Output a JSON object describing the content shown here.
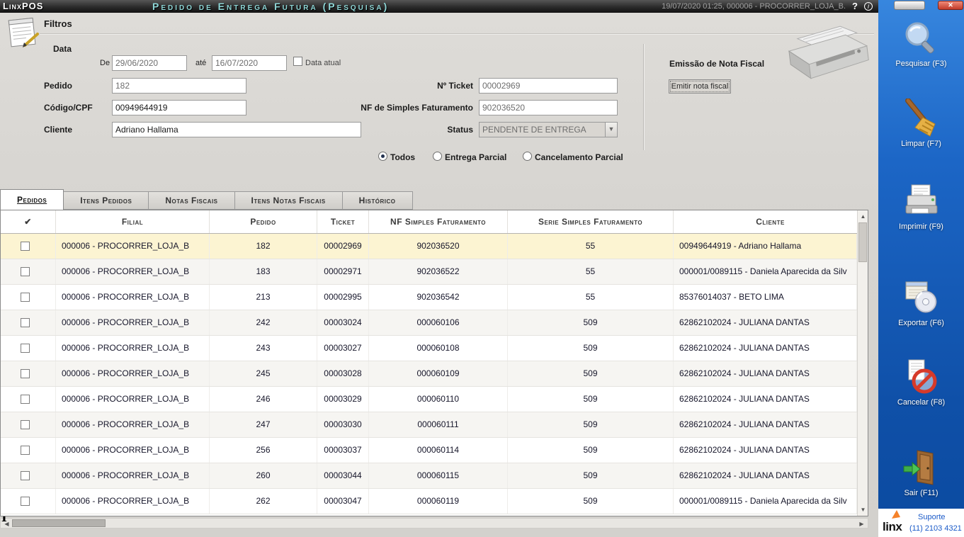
{
  "titlebar": {
    "app": "LinxPOS",
    "title": "Pedido de Entrega Futura (Pesquisa)",
    "session": "19/07/2020 01:25, 000006 - PROCORRER_LOJA_B.",
    "help_glyph": "?",
    "info_glyph": "i",
    "close_glyph": "✕"
  },
  "filters": {
    "heading": "Filtros",
    "data_label": "Data",
    "de_label": "De",
    "de_value": "29/06/2020",
    "ate_label": "até",
    "ate_value": "16/07/2020",
    "data_atual_label": "Data atual",
    "pedido_label": "Pedido",
    "pedido_value": "182",
    "codigo_label": "Código/CPF",
    "codigo_value": "00949644919",
    "cliente_label": "Cliente",
    "cliente_value": "Adriano Hallama",
    "ticket_label": "Nº Ticket",
    "ticket_value": "00002969",
    "nf_label": "NF de Simples Faturamento",
    "nf_value": "902036520",
    "status_label": "Status",
    "status_value": "PENDENTE DE ENTREGA",
    "radios": [
      {
        "label": "Todos",
        "checked": true
      },
      {
        "label": "Entrega Parcial",
        "checked": false
      },
      {
        "label": "Cancelamento Parcial",
        "checked": false
      }
    ],
    "emissao_label": "Emissão de Nota Fiscal",
    "emitir_button": "Emitir nota fiscal"
  },
  "tabs": [
    {
      "label": "Pedidos"
    },
    {
      "label": "Itens Pedidos"
    },
    {
      "label": "Notas Fiscais"
    },
    {
      "label": "Itens Notas Fiscais"
    },
    {
      "label": "Histórico"
    }
  ],
  "table": {
    "check_header_glyph": "✔",
    "columns": [
      "Filial",
      "Pedido",
      "Ticket",
      "NF Simples Faturamento",
      "Serie Simples Faturamento",
      "Cliente"
    ],
    "rows": [
      {
        "filial": "000006 - PROCORRER_LOJA_B",
        "pedido": "182",
        "ticket": "00002969",
        "nf": "902036520",
        "serie": "55",
        "cliente": "00949644919 - Adriano Hallama",
        "selected": true
      },
      {
        "filial": "000006 - PROCORRER_LOJA_B",
        "pedido": "183",
        "ticket": "00002971",
        "nf": "902036522",
        "serie": "55",
        "cliente": "000001/0089115 - Daniela Aparecida da Silv",
        "selected": false
      },
      {
        "filial": "000006 - PROCORRER_LOJA_B",
        "pedido": "213",
        "ticket": "00002995",
        "nf": "902036542",
        "serie": "55",
        "cliente": "85376014037 - BETO LIMA",
        "selected": false
      },
      {
        "filial": "000006 - PROCORRER_LOJA_B",
        "pedido": "242",
        "ticket": "00003024",
        "nf": "000060106",
        "serie": "509",
        "cliente": "62862102024 - JULIANA DANTAS",
        "selected": false
      },
      {
        "filial": "000006 - PROCORRER_LOJA_B",
        "pedido": "243",
        "ticket": "00003027",
        "nf": "000060108",
        "serie": "509",
        "cliente": "62862102024 - JULIANA DANTAS",
        "selected": false
      },
      {
        "filial": "000006 - PROCORRER_LOJA_B",
        "pedido": "245",
        "ticket": "00003028",
        "nf": "000060109",
        "serie": "509",
        "cliente": "62862102024 - JULIANA DANTAS",
        "selected": false
      },
      {
        "filial": "000006 - PROCORRER_LOJA_B",
        "pedido": "246",
        "ticket": "00003029",
        "nf": "000060110",
        "serie": "509",
        "cliente": "62862102024 - JULIANA DANTAS",
        "selected": false
      },
      {
        "filial": "000006 - PROCORRER_LOJA_B",
        "pedido": "247",
        "ticket": "00003030",
        "nf": "000060111",
        "serie": "509",
        "cliente": "62862102024 - JULIANA DANTAS",
        "selected": false
      },
      {
        "filial": "000006 - PROCORRER_LOJA_B",
        "pedido": "256",
        "ticket": "00003037",
        "nf": "000060114",
        "serie": "509",
        "cliente": "62862102024 - JULIANA DANTAS",
        "selected": false
      },
      {
        "filial": "000006 - PROCORRER_LOJA_B",
        "pedido": "260",
        "ticket": "00003044",
        "nf": "000060115",
        "serie": "509",
        "cliente": "62862102024 - JULIANA DANTAS",
        "selected": false
      },
      {
        "filial": "000006 - PROCORRER_LOJA_B",
        "pedido": "262",
        "ticket": "00003047",
        "nf": "000060119",
        "serie": "509",
        "cliente": "000001/0089115 - Daniela Aparecida da Silv",
        "selected": false
      }
    ]
  },
  "glyphs": {
    "up": "▲",
    "down": "▼",
    "left": "◀",
    "right": "▶",
    "dropdown": "▼",
    "ibeam": "I"
  },
  "sidebar": {
    "buttons": [
      {
        "label": "Pesquisar (F3)"
      },
      {
        "label": "Limpar (F7)"
      },
      {
        "label": "Imprimir (F9)"
      },
      {
        "label": "Exportar (F6)"
      },
      {
        "label": "Cancelar (F8)"
      },
      {
        "label": "Sair (F11)"
      }
    ],
    "support": {
      "brand": "linx",
      "line1": "Suporte",
      "line2": "(11) 2103 4321"
    }
  }
}
